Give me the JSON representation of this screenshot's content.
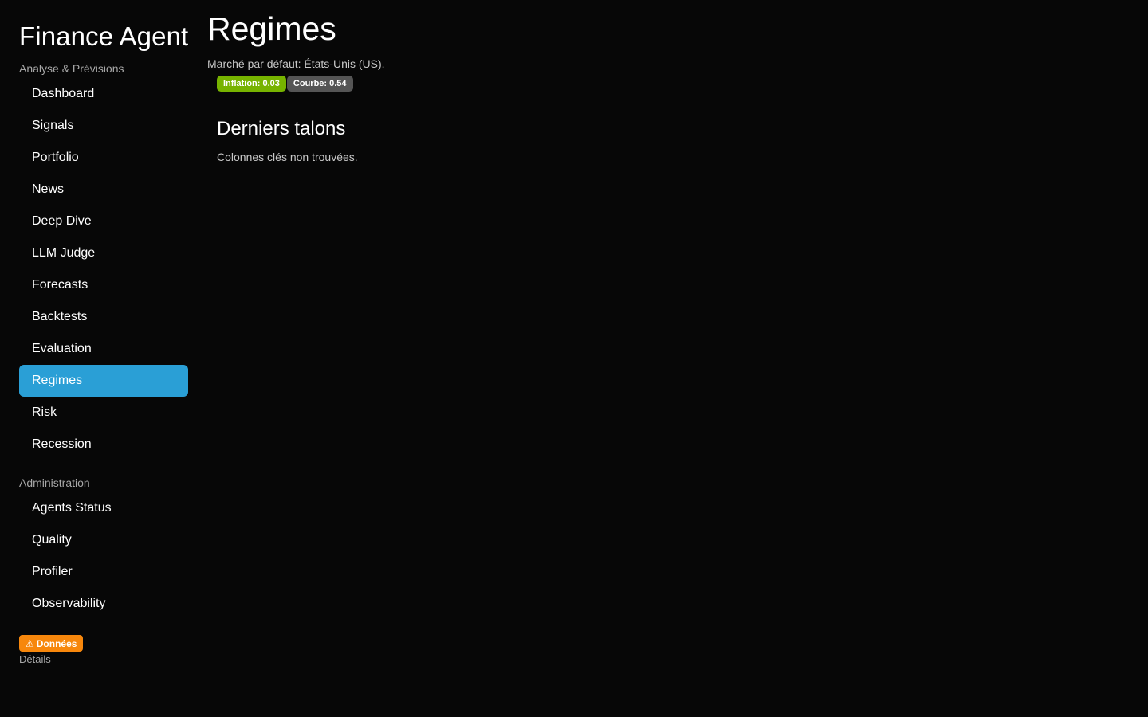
{
  "app": {
    "title": "Finance Agent"
  },
  "sidebar": {
    "sections": [
      {
        "label": "Analyse & Prévisions",
        "items": [
          {
            "label": "Dashboard"
          },
          {
            "label": "Signals"
          },
          {
            "label": "Portfolio"
          },
          {
            "label": "News"
          },
          {
            "label": "Deep Dive"
          },
          {
            "label": "LLM Judge"
          },
          {
            "label": "Forecasts"
          },
          {
            "label": "Backtests"
          },
          {
            "label": "Evaluation"
          },
          {
            "label": "Regimes",
            "active": true
          },
          {
            "label": "Risk"
          },
          {
            "label": "Recession"
          }
        ]
      },
      {
        "label": "Administration",
        "items": [
          {
            "label": "Agents Status"
          },
          {
            "label": "Quality"
          },
          {
            "label": "Profiler"
          },
          {
            "label": "Observability"
          }
        ]
      }
    ],
    "data_warning": {
      "icon": "warning-icon",
      "glyph": "⚠",
      "label": "Données",
      "color": "#f7870c"
    },
    "details_label": "Détails"
  },
  "main": {
    "title": "Regimes",
    "market_note": "Marché par défaut: États-Unis (US).",
    "badges": [
      {
        "label": "Inflation: 0.03",
        "color": "#77b300"
      },
      {
        "label": "Courbe: 0.54",
        "color": "#555555"
      }
    ],
    "section_title": "Derniers talons",
    "empty_message": "Colonnes clés non trouvées."
  },
  "theme": {
    "background": "#070707",
    "accent": "#2a9fd6"
  }
}
